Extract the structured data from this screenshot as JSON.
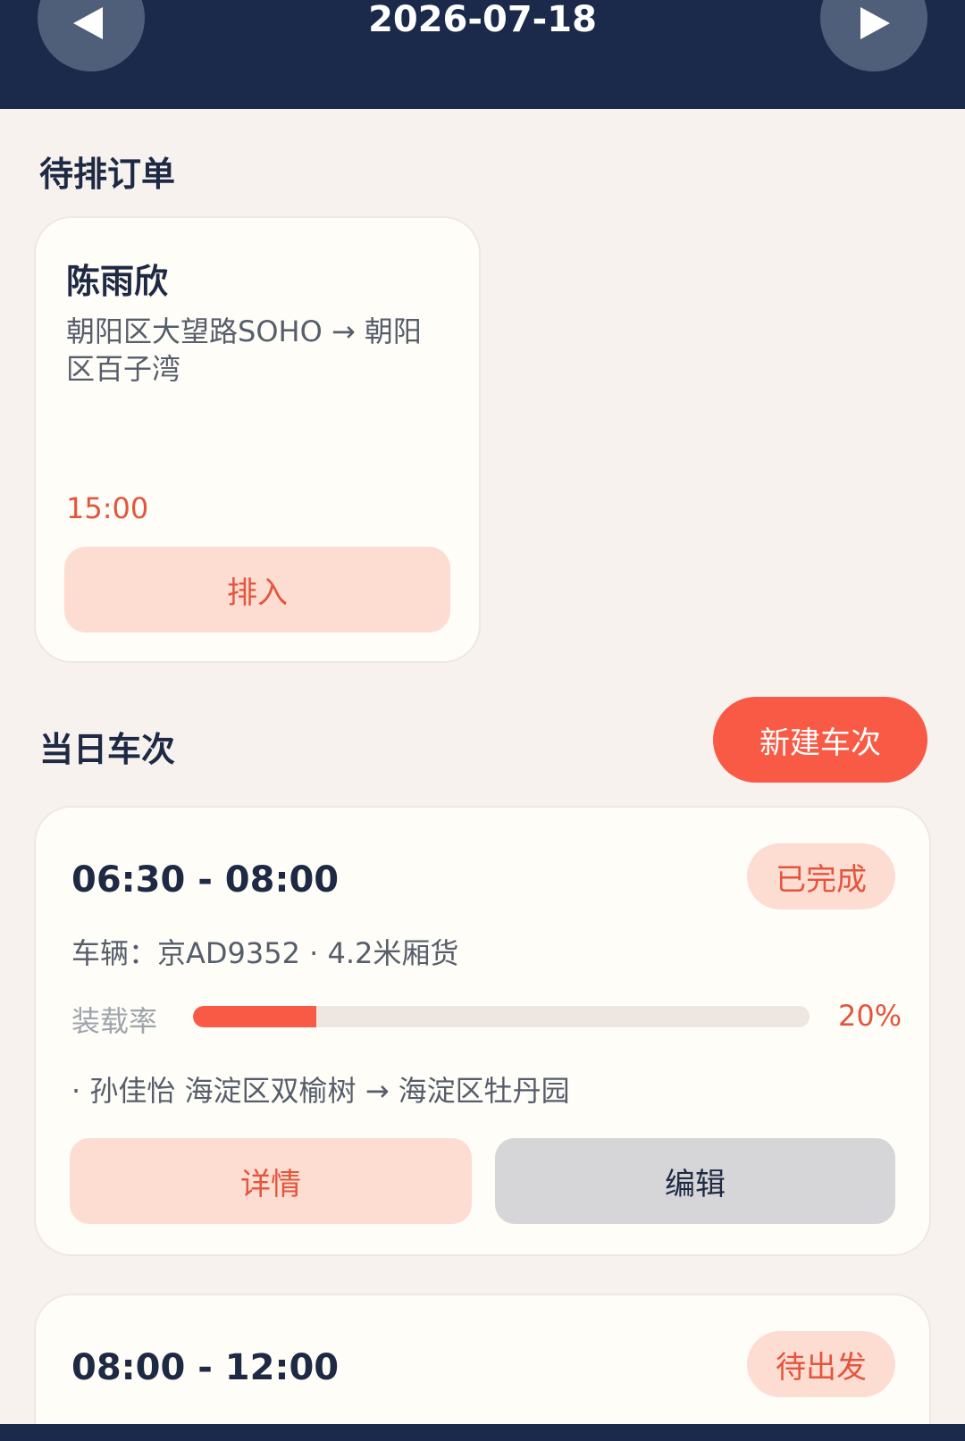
{
  "header": {
    "date": "2026-07-18",
    "prev_icon": "triangle-left-icon",
    "next_icon": "triangle-right-icon"
  },
  "pending": {
    "title": "待排订单",
    "orders": [
      {
        "name": "陈雨欣",
        "route": "朝阳区大望路SOHO → 朝阳区百子湾",
        "time": "15:00",
        "insert_label": "排入"
      }
    ]
  },
  "trips": {
    "title": "当日车次",
    "new_trip_label": "新建车次",
    "items": [
      {
        "time_range": "06:30 - 08:00",
        "status": "已完成",
        "vehicle": "车辆：京AD9352 · 4.2米厢货",
        "load_label": "装载率",
        "load_percent": 20,
        "load_text": "20%",
        "stops": [
          "· 孙佳怡 海淀区双榆树 → 海淀区牡丹园"
        ],
        "detail_label": "详情",
        "edit_label": "编辑"
      },
      {
        "time_range": "08:00 - 12:00",
        "status": "待出发"
      }
    ]
  },
  "colors": {
    "header_bg": "#1b2a4a",
    "accent": "#f85a45",
    "accent_soft": "#fddcd2",
    "page_bg": "#f7f2ee"
  }
}
